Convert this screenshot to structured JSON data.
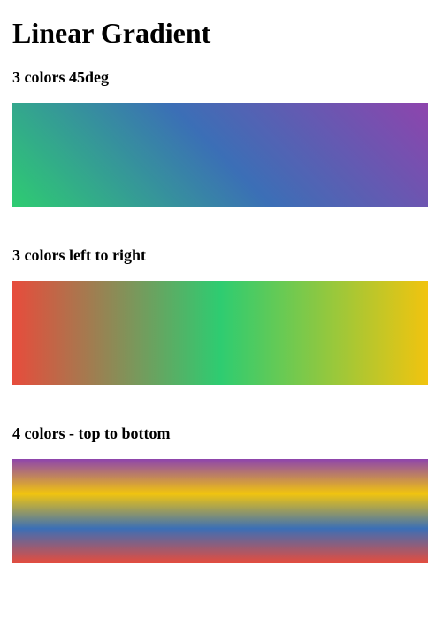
{
  "title": "Linear Gradient",
  "sections": [
    {
      "label": "3 colors 45deg",
      "gradient": {
        "direction": "45deg",
        "colors": [
          "#2ecc71",
          "#3b6fb6",
          "#8e44ad"
        ]
      }
    },
    {
      "label": "3 colors left to right",
      "gradient": {
        "direction": "to right",
        "colors": [
          "#e74c3c",
          "#2ecc71",
          "#f1c40f"
        ]
      }
    },
    {
      "label": "4 colors - top to bottom",
      "gradient": {
        "direction": "to bottom",
        "colors": [
          "#8e44ad",
          "#f1c40f",
          "#3b6fb6",
          "#e74c3c"
        ]
      }
    }
  ]
}
